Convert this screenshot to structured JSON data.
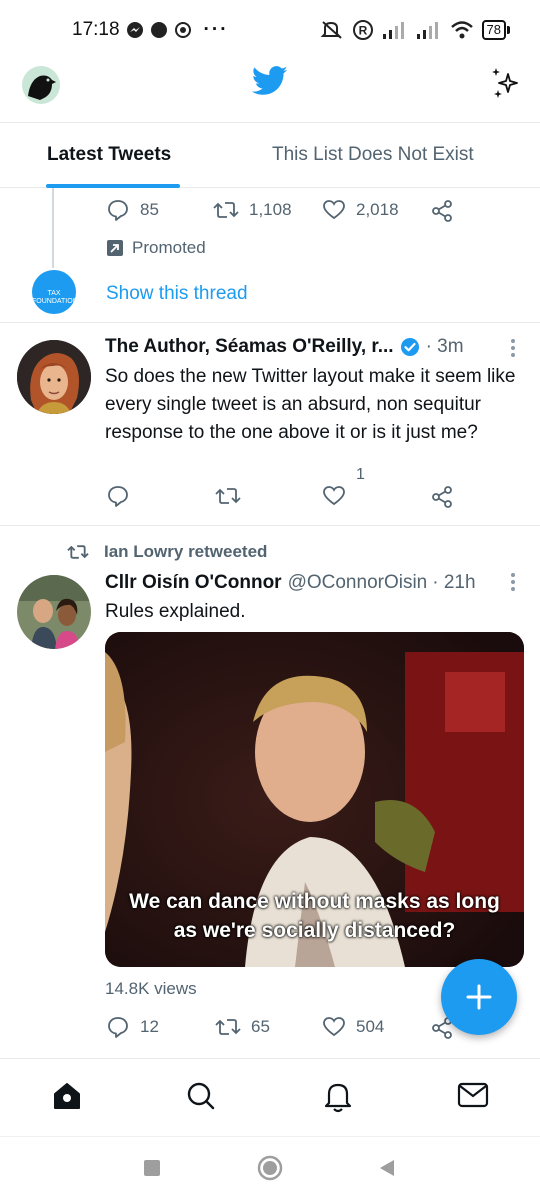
{
  "status_bar": {
    "time": "17:18",
    "battery": "78"
  },
  "header": {
    "logo": "twitter-bird-icon",
    "accent_color": "#1d9bf0"
  },
  "tabs": [
    {
      "label": "Latest Tweets",
      "active": true
    },
    {
      "label": "This List Does Not Exist",
      "active": false
    }
  ],
  "thread_tail": {
    "actions": {
      "replies": "85",
      "retweets": "1,108",
      "likes": "2,018"
    },
    "promoted_label": "Promoted",
    "avatar_text": "TAX FOUNDATION",
    "show_thread_label": "Show this thread"
  },
  "tweets": [
    {
      "name": "The Author, Séamas O'Reilly, r...",
      "verified": true,
      "handle": "",
      "time": "· 3m",
      "text": "So does the new Twitter layout make it seem like every single tweet is an absurd, non sequitur response to the one above it or is it just me?",
      "replies": "",
      "retweets": "",
      "likes": "1"
    },
    {
      "retweeted_by": "Ian Lowry retweeted",
      "name": "Cllr Oisín O'Connor",
      "handle": "@OConnorOisin",
      "time": "· 21h",
      "text": "Rules explained.",
      "media_caption_line1": "We can dance without masks as long",
      "media_caption_line2": "as we're socially distanced?",
      "views": "14.8K views",
      "replies": "12",
      "retweets": "65",
      "likes": "504"
    }
  ],
  "bottom_nav": [
    "home-icon",
    "search-icon",
    "notifications-icon",
    "messages-icon"
  ],
  "fab": {
    "icon": "plus-icon"
  }
}
